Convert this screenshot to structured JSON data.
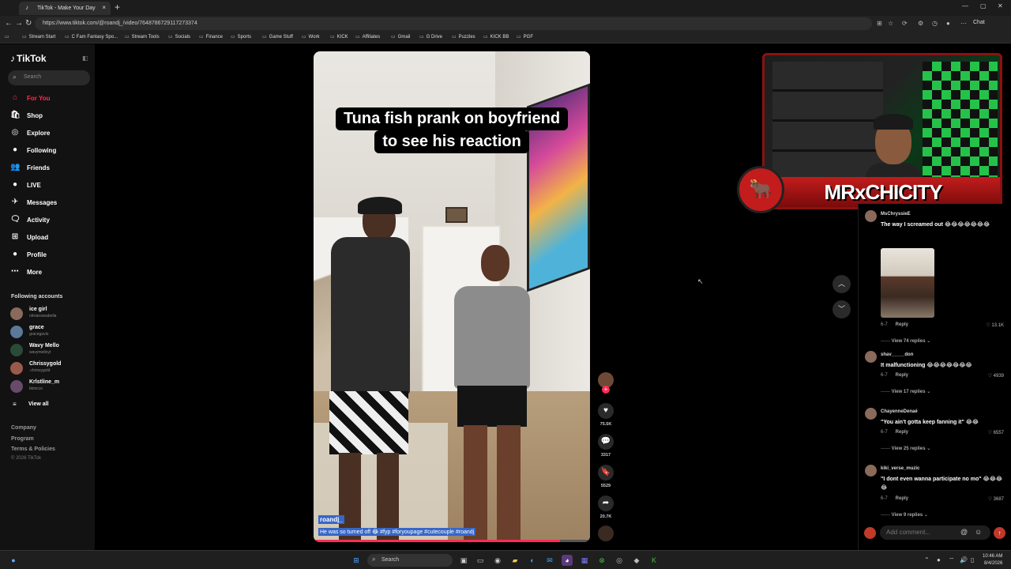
{
  "browser": {
    "tab_title": "TikTok - Make Your Day",
    "tab_close": "×",
    "new_tab": "+",
    "url": "https://www.tiktok.com/@roandj_/video/7648786729117273374",
    "chat_label": "Chat",
    "bookmarks": [
      "Stream Start",
      "C Fam Fantasy Spo...",
      "Stream Tools",
      "Socials",
      "Finance",
      "Sports",
      "Game Stuff",
      "Work",
      "KICK",
      "Affiliates",
      "Gmail",
      "G Drive",
      "Puzzles",
      "KICK BB",
      "PGF"
    ]
  },
  "sidebar": {
    "logo": "TikTok",
    "search_placeholder": "Search",
    "nav": [
      {
        "label": "For You",
        "icon": "home-icon",
        "glyph": "⌂"
      },
      {
        "label": "Shop",
        "icon": "shop-icon",
        "glyph": "🛍"
      },
      {
        "label": "Explore",
        "icon": "explore-icon",
        "glyph": "◎"
      },
      {
        "label": "Following",
        "icon": "following-icon",
        "glyph": "●"
      },
      {
        "label": "Friends",
        "icon": "friends-icon",
        "glyph": "👥"
      },
      {
        "label": "LIVE",
        "icon": "live-icon",
        "glyph": "●"
      },
      {
        "label": "Messages",
        "icon": "messages-icon",
        "glyph": "✈"
      },
      {
        "label": "Activity",
        "icon": "activity-icon",
        "glyph": "🗨"
      },
      {
        "label": "Upload",
        "icon": "upload-icon",
        "glyph": "⊞"
      },
      {
        "label": "Profile",
        "icon": "profile-icon",
        "glyph": "●"
      },
      {
        "label": "More",
        "icon": "more-icon",
        "glyph": "⋯"
      }
    ],
    "following_title": "Following accounts",
    "accounts": [
      {
        "name": "ice girl",
        "handle": "oliviaroseabella"
      },
      {
        "name": "grace",
        "handle": "gracegavio"
      },
      {
        "name": "Wavy Mello",
        "handle": "wavymelloyt"
      },
      {
        "name": "Chrissygold",
        "handle": ".chrissygold"
      },
      {
        "name": "Krlstline_m",
        "handle": "kkmcco"
      }
    ],
    "view_all": "View all",
    "footer": [
      "Company",
      "Program",
      "Terms & Policies"
    ],
    "copyright": "© 2026 TikTok"
  },
  "video": {
    "caption_line1": "Tuna fish prank on boyfriend",
    "caption_line2": "to see his reaction",
    "username": "roandj_",
    "description": "He was so turned off 😂 #fyp #foryoupage #cutecouple #roandj",
    "progress": 0.89
  },
  "actions": {
    "likes": "75.5K",
    "comments": "3317",
    "saves": "5529",
    "shares": "20.7K"
  },
  "overlay": {
    "streamer_name": "MRxCHICITY"
  },
  "comments": [
    {
      "user": "MsChryssieE",
      "text": "The way I screamed out 😂😂😂😂😂😂😂",
      "date": "6-7",
      "reply": "Reply",
      "likes": "13.1K",
      "view_replies": "View 74 replies ⌄"
    },
    {
      "user": "shav_____don",
      "text": "It malfunctioning 😂😂😂😂😂😂😂",
      "date": "6-7",
      "reply": "Reply",
      "likes": "4939",
      "view_replies": "View 17 replies ⌄"
    },
    {
      "user": "ChayenneDenaé",
      "text": "\"You ain't gotta keep fanning it\" 😂😂",
      "date": "6-7",
      "reply": "Reply",
      "likes": "6557",
      "view_replies": "View 25 replies ⌄"
    },
    {
      "user": "kiki_verse_muzic",
      "text": "\"I dont even wanna participate no mo\" 😂😂😂😂",
      "date": "6-7",
      "reply": "Reply",
      "likes": "3687",
      "view_replies": "View 9 replies ⌄"
    }
  ],
  "add_comment_placeholder": "Add comment...",
  "taskbar": {
    "search": "Search",
    "time": "10:46 AM",
    "date": "8/4/2026"
  }
}
